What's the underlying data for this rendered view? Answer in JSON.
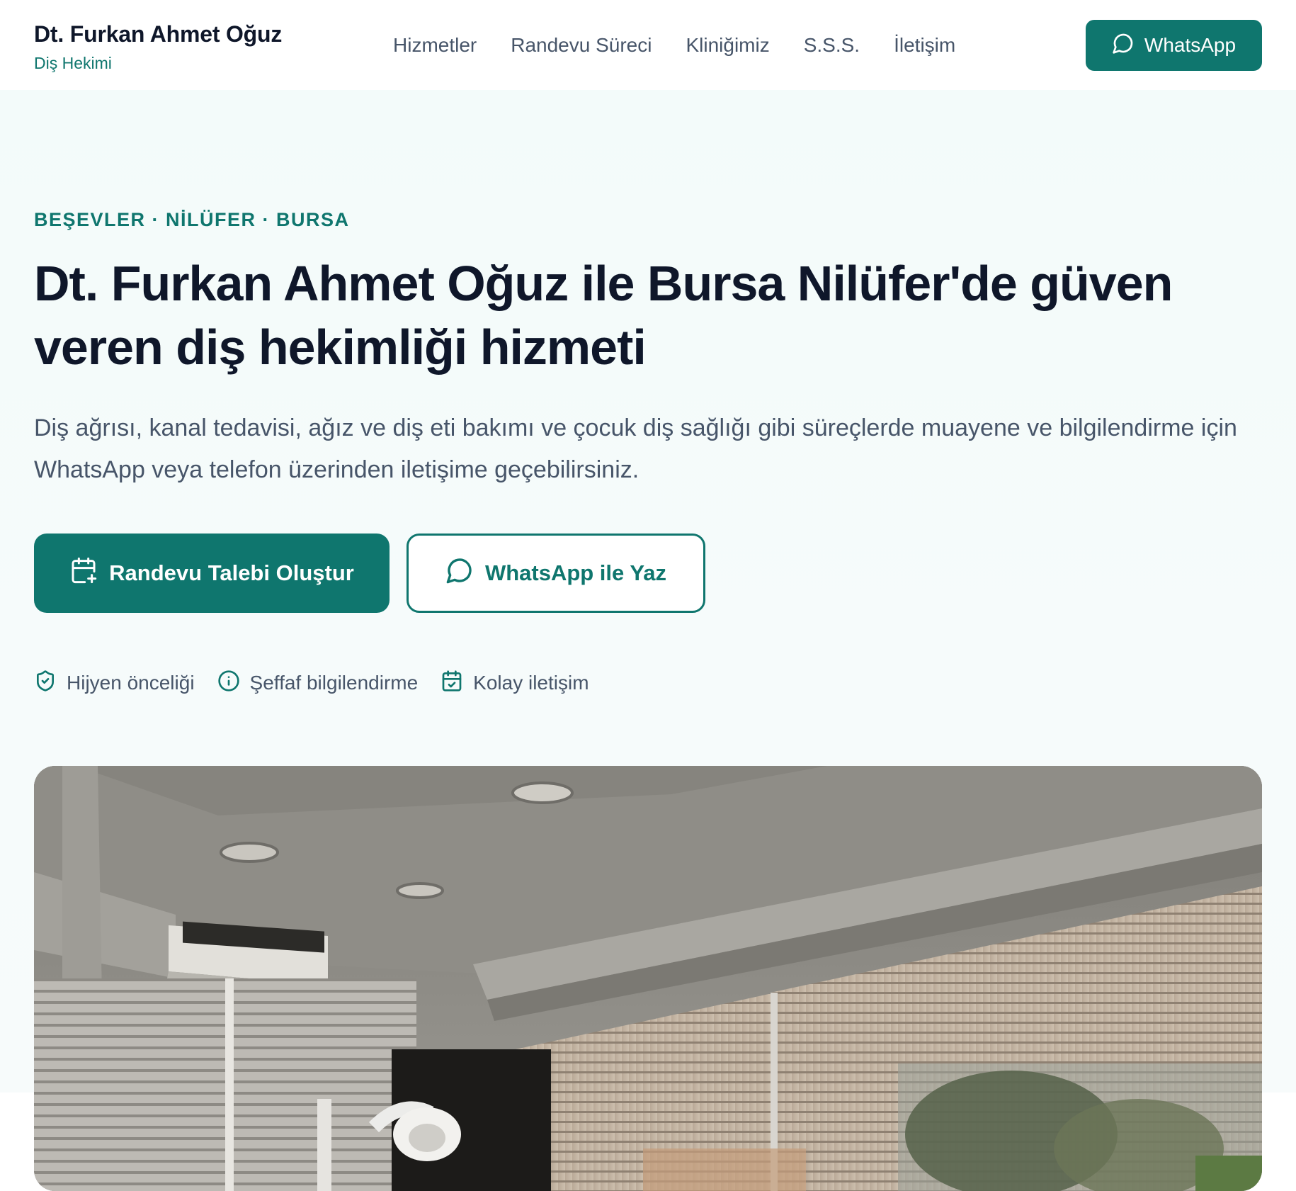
{
  "header": {
    "brand_name": "Dt. Furkan Ahmet Oğuz",
    "brand_sub": "Diş Hekimi",
    "nav": [
      {
        "label": "Hizmetler"
      },
      {
        "label": "Randevu Süreci"
      },
      {
        "label": "Kliniğimiz"
      },
      {
        "label": "S.S.S."
      },
      {
        "label": "İletişim"
      }
    ],
    "whatsapp_label": "WhatsApp"
  },
  "hero": {
    "kicker": "BEŞEVLER · NİLÜFER · BURSA",
    "title": "Dt. Furkan Ahmet Oğuz ile Bursa Nilüfer'de güven veren diş hekimliği hizmeti",
    "lead": "Diş ağrısı, kanal tedavisi, ağız ve diş eti bakımı ve çocuk diş sağlığı gibi süreçlerde muayene ve bilgilendirme için WhatsApp veya telefon üzerinden iletişime geçebilirsiniz.",
    "primary_button": "Randevu Talebi Oluştur",
    "secondary_button": "WhatsApp ile Yaz",
    "features": [
      {
        "icon": "shield-check-icon",
        "label": "Hijyen önceliği"
      },
      {
        "icon": "info-icon",
        "label": "Şeffaf bilgilendirme"
      },
      {
        "icon": "calendar-check-icon",
        "label": "Kolay iletişim"
      }
    ]
  },
  "colors": {
    "accent": "#0f766e",
    "heading": "#0f172a",
    "body_text": "#475569",
    "hero_bg": "#f3fbfa"
  }
}
